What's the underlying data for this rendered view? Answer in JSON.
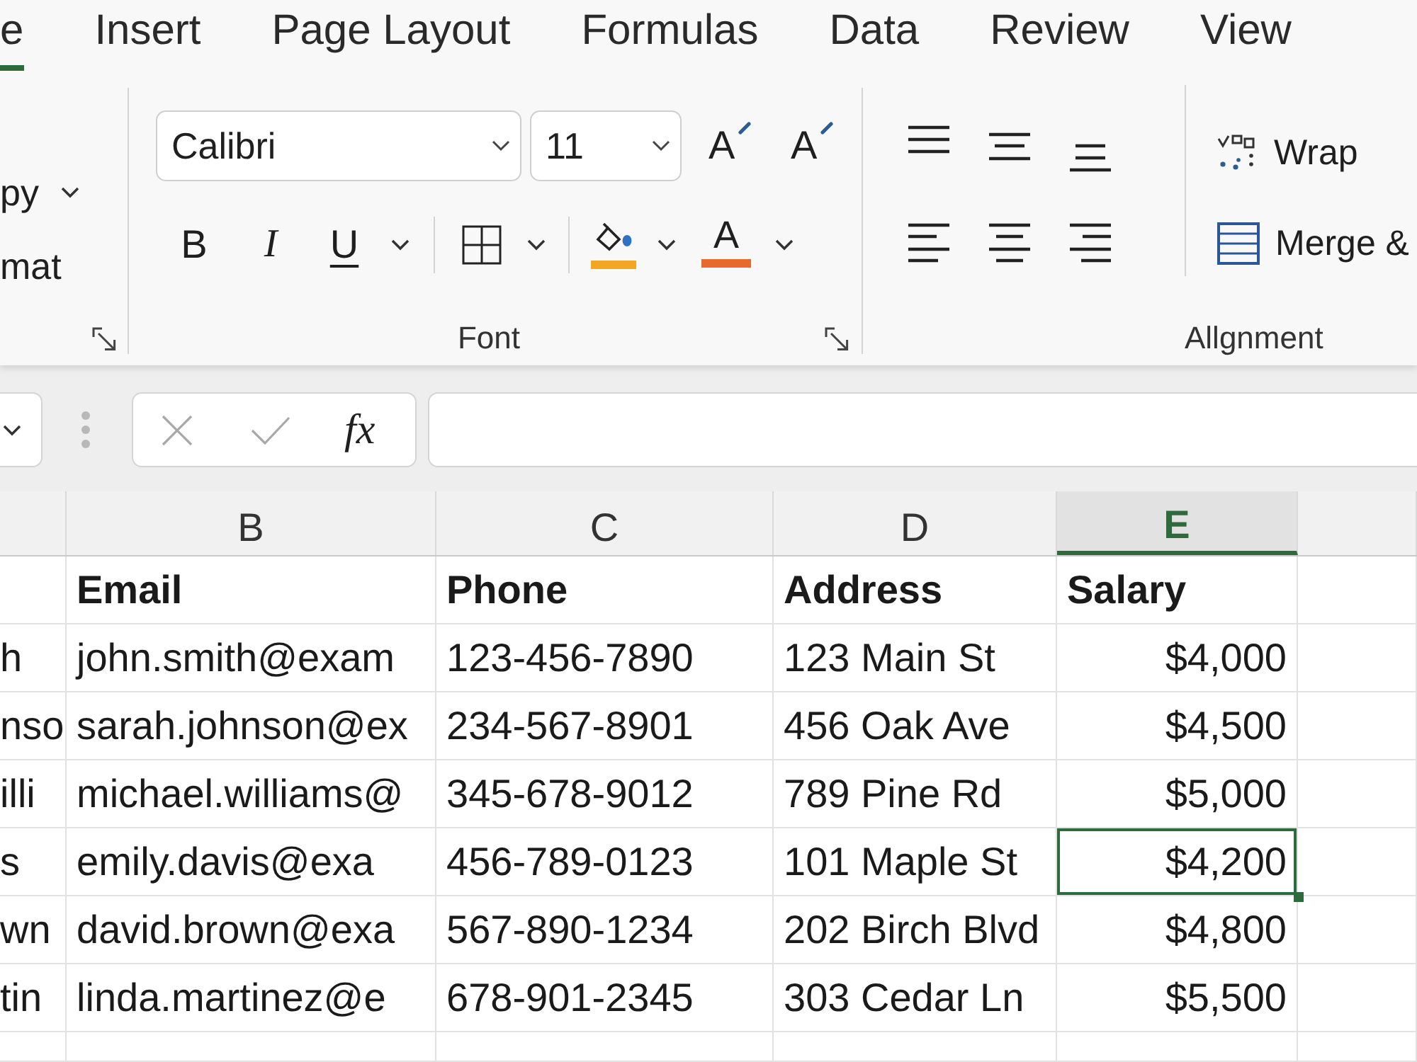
{
  "ribbon_tabs": [
    {
      "label": "e",
      "selected": true
    },
    {
      "label": "Insert",
      "selected": false
    },
    {
      "label": "Page Layout",
      "selected": false
    },
    {
      "label": "Formulas",
      "selected": false
    },
    {
      "label": "Data",
      "selected": false
    },
    {
      "label": "Review",
      "selected": false
    },
    {
      "label": "View",
      "selected": false
    }
  ],
  "clipboard_group": {
    "copy_label": "py",
    "format_label": "mat"
  },
  "font_group": {
    "font_name": "Calibri",
    "font_size": "11",
    "grow_label": "A",
    "shrink_label": "A",
    "bold_label": "B",
    "italic_label": "I",
    "underline_label": "U",
    "fill_button": {
      "color": "#f2a623"
    },
    "font_color_button": {
      "label": "A",
      "color": "#e8692b"
    },
    "title": "Font"
  },
  "alignment_group": {
    "wrap_label": "Wrap",
    "merge_label": "Merge &",
    "title": "Allgnment"
  },
  "formula_bar": {
    "function_label": "fx"
  },
  "sheet": {
    "columns": [
      {
        "kind": "text",
        "selected": false
      },
      {
        "label": "B",
        "kind": "text",
        "selected": false
      },
      {
        "label": "C",
        "kind": "text",
        "selected": false
      },
      {
        "label": "D",
        "kind": "text",
        "selected": false
      },
      {
        "label": "E",
        "kind": "currency",
        "selected": true
      }
    ],
    "rows": [
      {
        "kind": "header",
        "cells": [
          {
            "selected": false
          },
          {
            "text": "Email",
            "selected": false
          },
          {
            "text": "Phone",
            "selected": false
          },
          {
            "text": "Address",
            "selected": false
          },
          {
            "text": "Salary",
            "selected": false
          }
        ]
      },
      {
        "kind": "data",
        "cells": [
          {
            "text": "h",
            "selected": false
          },
          {
            "text": "john.smith@exam",
            "selected": false
          },
          {
            "text": "123-456-7890",
            "selected": false
          },
          {
            "text": "123 Main St",
            "selected": false
          },
          {
            "text": "$4,000",
            "selected": false
          }
        ]
      },
      {
        "kind": "data",
        "cells": [
          {
            "text": "nso",
            "selected": false
          },
          {
            "text": "sarah.johnson@ex",
            "selected": false
          },
          {
            "text": "234-567-8901",
            "selected": false
          },
          {
            "text": "456 Oak Ave",
            "selected": false
          },
          {
            "text": "$4,500",
            "selected": false
          }
        ]
      },
      {
        "kind": "data",
        "cells": [
          {
            "text": "illi",
            "selected": false
          },
          {
            "text": "michael.williams@",
            "selected": false
          },
          {
            "text": "345-678-9012",
            "selected": false
          },
          {
            "text": "789 Pine Rd",
            "selected": false
          },
          {
            "text": "$5,000",
            "selected": false
          }
        ]
      },
      {
        "kind": "data",
        "cells": [
          {
            "text": "s",
            "selected": false
          },
          {
            "text": "emily.davis@exa",
            "selected": false
          },
          {
            "text": "456-789-0123",
            "selected": false
          },
          {
            "text": "101 Maple St",
            "selected": false
          },
          {
            "text": "$4,200",
            "selected": true
          }
        ]
      },
      {
        "kind": "data",
        "cells": [
          {
            "text": "wn",
            "selected": false
          },
          {
            "text": "david.brown@exa",
            "selected": false
          },
          {
            "text": "567-890-1234",
            "selected": false
          },
          {
            "text": "202 Birch Blvd",
            "selected": false
          },
          {
            "text": "$4,800",
            "selected": false
          }
        ]
      },
      {
        "kind": "data",
        "cells": [
          {
            "text": "tin",
            "selected": false
          },
          {
            "text": "linda.martinez@e",
            "selected": false
          },
          {
            "text": "678-901-2345",
            "selected": false
          },
          {
            "text": "303 Cedar Ln",
            "selected": false
          },
          {
            "text": "$5,500",
            "selected": false
          }
        ]
      }
    ]
  }
}
